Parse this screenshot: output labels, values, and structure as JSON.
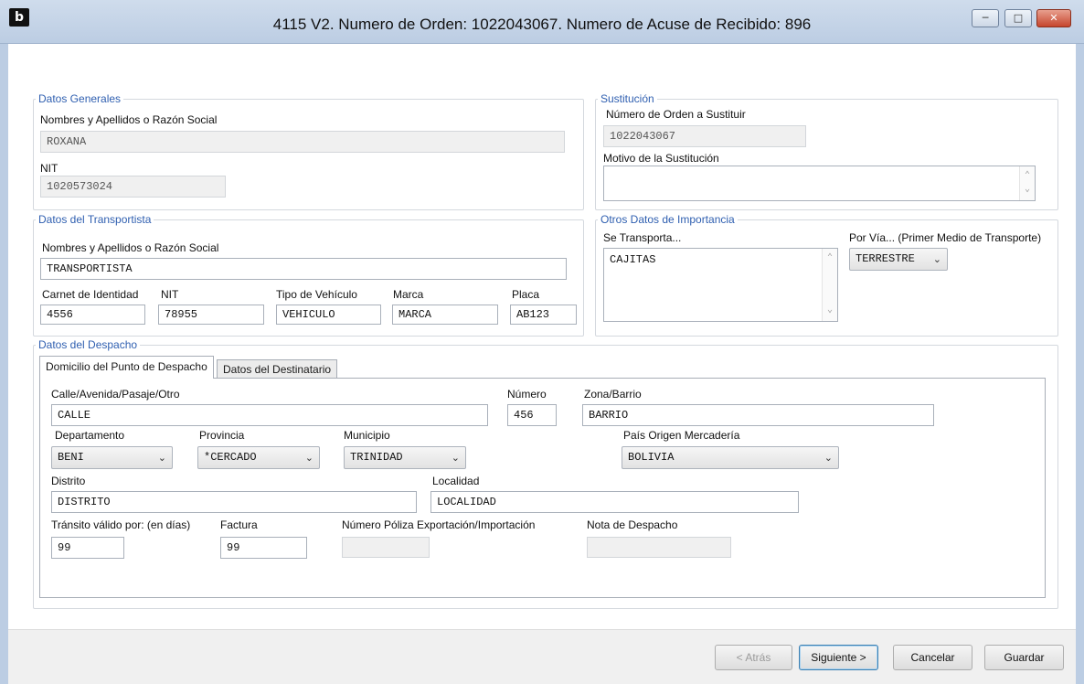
{
  "window": {
    "title": "4115 V2. Numero de Orden: 1022043067. Numero de Acuse de Recibido: 896",
    "app_icon": "b",
    "minimize_icon": "minimize-icon",
    "maximize_icon": "maximize-icon",
    "close_icon": "close-icon"
  },
  "datos_generales": {
    "legend": "Datos Generales",
    "nombre_label": "Nombres y Apellidos o Razón Social",
    "nombre_value": "ROXANA",
    "nit_label": "NIT",
    "nit_value": "1020573024"
  },
  "sustitucion": {
    "legend": "Sustitución",
    "orden_label": "Número de Orden a Sustituir",
    "orden_value": "1022043067",
    "motivo_label": "Motivo de la Sustitución",
    "motivo_value": ""
  },
  "transportista": {
    "legend": "Datos del Transportista",
    "nombre_label": "Nombres y Apellidos o Razón Social",
    "nombre_value": "TRANSPORTISTA",
    "carnet_label": "Carnet de Identidad",
    "carnet_value": "4556",
    "nit_label": "NIT",
    "nit_value": "78955",
    "tipo_label": "Tipo de Vehículo",
    "tipo_value": "VEHICULO",
    "marca_label": "Marca",
    "marca_value": "MARCA",
    "placa_label": "Placa",
    "placa_value": "AB123"
  },
  "otros_datos": {
    "legend": "Otros Datos de Importancia",
    "transporta_label": "Se Transporta...",
    "transporta_value": "CAJITAS",
    "via_label": "Por Vía... (Primer Medio de Transporte)",
    "via_value": "TERRESTRE"
  },
  "despacho": {
    "legend": "Datos del Despacho",
    "tabs": [
      {
        "label": "Domicilio del Punto de Despacho",
        "active": true
      },
      {
        "label": "Datos del Destinatario",
        "active": false
      }
    ],
    "calle_label": "Calle/Avenida/Pasaje/Otro",
    "calle_value": "CALLE",
    "numero_label": "Número",
    "numero_value": "456",
    "zona_label": "Zona/Barrio",
    "zona_value": "BARRIO",
    "departamento_label": "Departamento",
    "departamento_value": "BENI",
    "provincia_label": "Provincia",
    "provincia_value": "*CERCADO",
    "municipio_label": "Municipio",
    "municipio_value": "TRINIDAD",
    "pais_label": "País Origen Mercadería",
    "pais_value": "BOLIVIA",
    "distrito_label": "Distrito",
    "distrito_value": "DISTRITO",
    "localidad_label": "Localidad",
    "localidad_value": "LOCALIDAD",
    "transito_label": "Tránsito válido por: (en días)",
    "transito_value": "99",
    "factura_label": "Factura",
    "factura_value": "99",
    "poliza_label": "Número Póliza Exportación/Importación",
    "poliza_value": "",
    "nota_label": "Nota de Despacho",
    "nota_value": ""
  },
  "buttons": {
    "atras": "< Atrás",
    "siguiente": "Siguiente >",
    "cancelar": "Cancelar",
    "guardar": "Guardar"
  }
}
